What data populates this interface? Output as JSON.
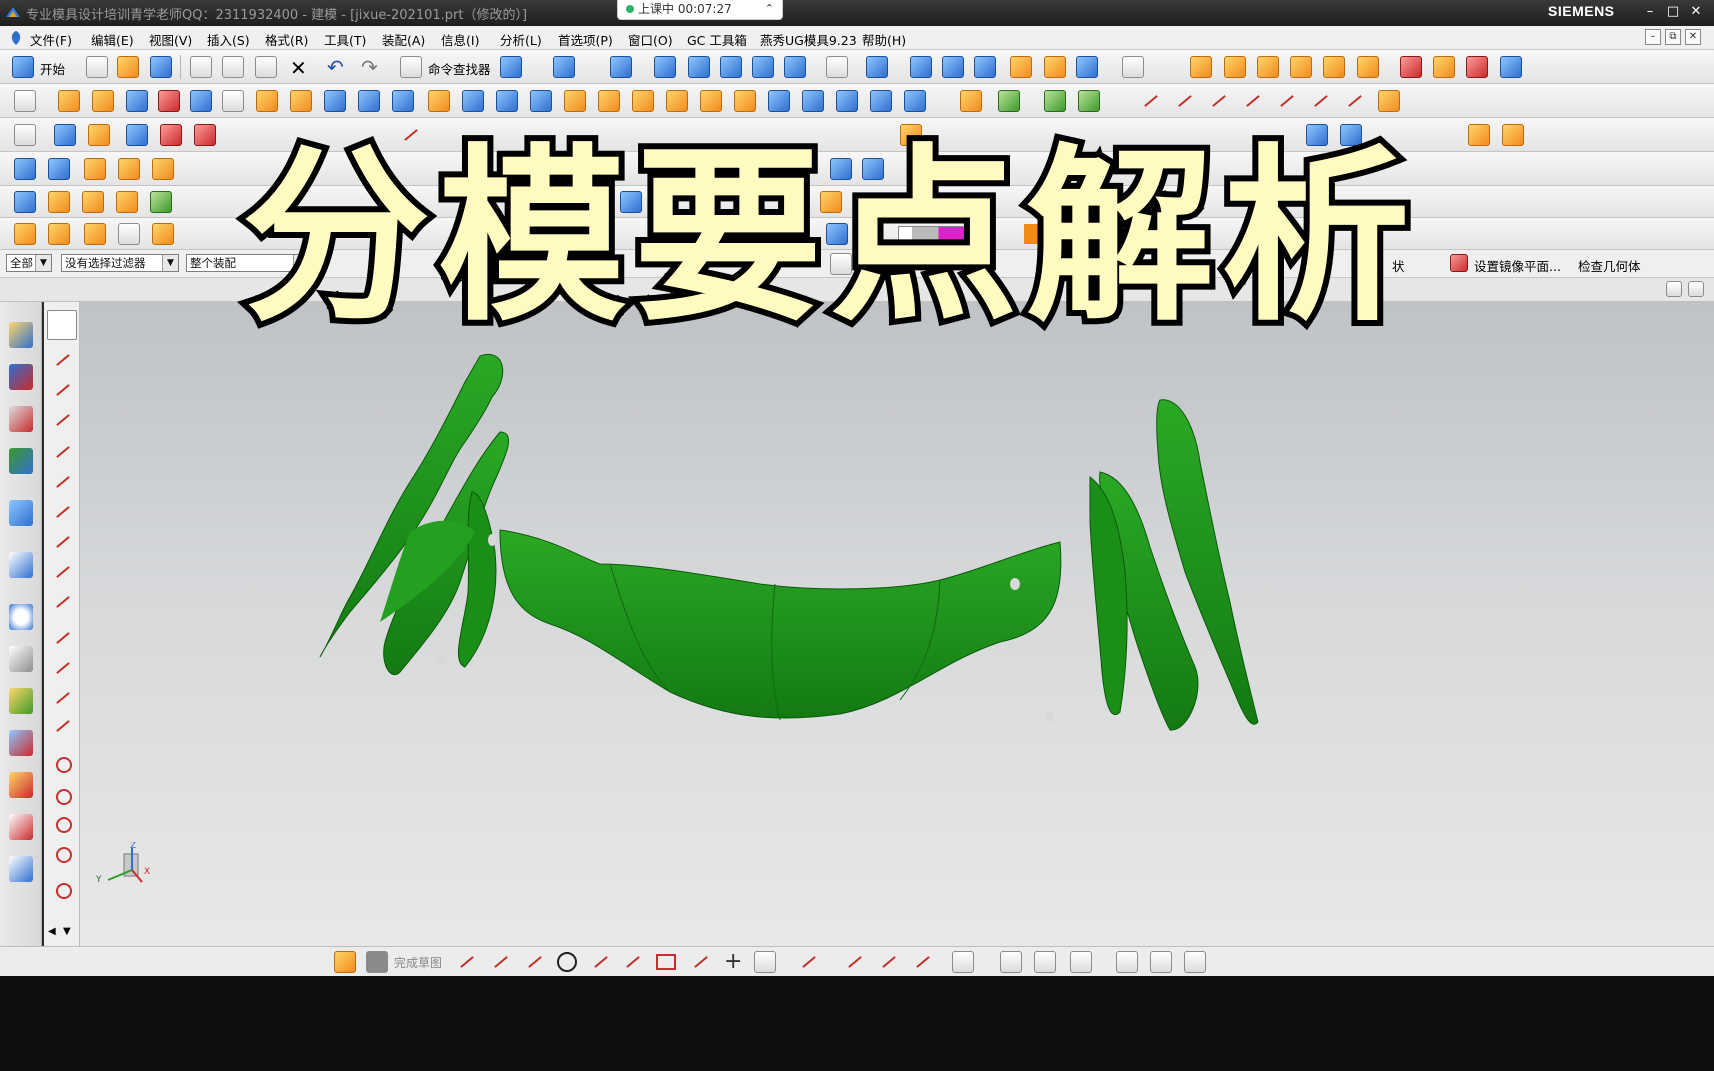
{
  "window": {
    "title": "专业模具设计培训青学老师QQ：2311932400 - 建模 - [jixue-202101.prt（修改的）]",
    "brand": "SIEMENS",
    "controls": [
      "minimize",
      "maximize",
      "close"
    ]
  },
  "recording": {
    "status": "上课中",
    "time": "00:07:27"
  },
  "menu": {
    "items": [
      "文件(F)",
      "编辑(E)",
      "视图(V)",
      "插入(S)",
      "格式(R)",
      "工具(T)",
      "装配(A)",
      "信息(I)",
      "分析(L)",
      "首选项(P)",
      "窗口(O)",
      "GC 工具箱",
      "燕秀UG模具9.23",
      "帮助(H)"
    ]
  },
  "toolbar": {
    "start_label": "开始",
    "command_finder_label": "命令查找器",
    "save_label": "保存",
    "shape_label": "状",
    "mirror_plane_label": "设置镜像平面...",
    "check_geometry_label": "检查几何体"
  },
  "selection": {
    "filter_all": "全部",
    "no_filter": "没有选择过滤器",
    "scope": "整个装配"
  },
  "sketch_bar": {
    "finish_sketch_label": "完成草图"
  },
  "triad": {
    "x": "X",
    "y": "Y",
    "z": "Z"
  },
  "overlay": {
    "title": "分模要点解析"
  },
  "colors": {
    "part": "#1f9a1a",
    "overlay_text": "#fffbc0",
    "overlay_stroke": "#000000",
    "brand": "#ffffff"
  },
  "icons": {
    "start": "ug-start-icon",
    "new": "new-file-icon",
    "open": "open-folder-icon",
    "save": "save-icon",
    "cut": "cut-icon",
    "copy": "copy-icon",
    "paste": "paste-icon",
    "delete": "delete-x-icon",
    "undo": "undo-icon",
    "redo": "redo-icon",
    "command_finder": "binoculars-icon"
  }
}
